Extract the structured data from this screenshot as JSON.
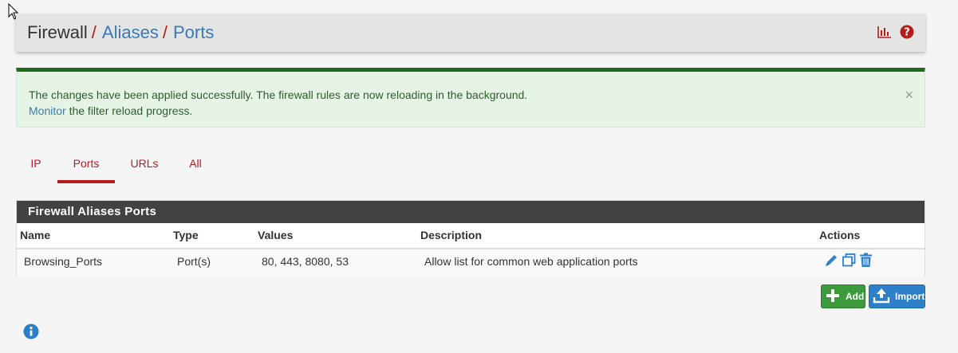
{
  "breadcrumb": {
    "root": "Firewall",
    "separator": "/",
    "level2": "Aliases",
    "level3": "Ports"
  },
  "header_icons": [
    "bar-chart-icon",
    "help-icon"
  ],
  "alert": {
    "line1": "The changes have been applied successfully. The firewall rules are now reloading in the background.",
    "link": "Monitor",
    "line2_rest": " the filter reload progress.",
    "close": "×"
  },
  "tabs": [
    {
      "label": "IP",
      "active": false
    },
    {
      "label": "Ports",
      "active": true
    },
    {
      "label": "URLs",
      "active": false
    },
    {
      "label": "All",
      "active": false
    }
  ],
  "panel": {
    "title": "Firewall Aliases Ports",
    "columns": [
      "Name",
      "Type",
      "Values",
      "Description",
      "Actions"
    ],
    "rows": [
      {
        "name": "Browsing_Ports",
        "type": "Port(s)",
        "values": "80, 443, 8080, 53",
        "description": "Allow list for common web application ports",
        "actions": [
          "edit-icon",
          "copy-icon",
          "delete-icon"
        ]
      }
    ]
  },
  "buttons": {
    "add": "Add",
    "import": "Import"
  },
  "colors": {
    "accent_red": "#b71c1c",
    "link_blue": "#3a7ab8",
    "success_green": "#1e6b1e",
    "panel_header": "#424242",
    "add_button": "#3c9a3c",
    "import_button": "#2d7fc8"
  }
}
